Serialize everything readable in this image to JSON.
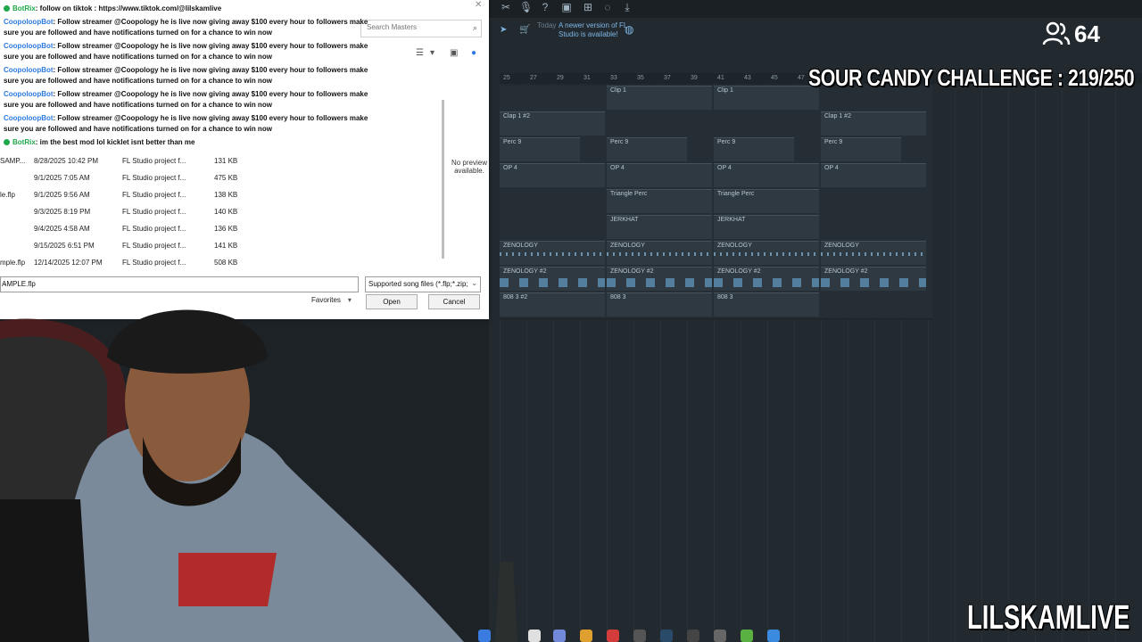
{
  "chat": [
    {
      "user": "BotRix",
      "badge": "green",
      "text": ": follow on tiktok : https://www.tiktok.com/@lilskamlive"
    },
    {
      "user": "CoopoloopBot",
      "badge": "none",
      "text": ": Follow streamer @Coopology he is live now giving away $100 every hour to followers make sure you are followed and have notifications turned on for a chance to win now"
    },
    {
      "user": "CoopoloopBot",
      "badge": "none",
      "text": ": Follow streamer @Coopology he is live now giving away $100 every hour to followers make sure you are followed and have notifications turned on for a chance to win now"
    },
    {
      "user": "CoopoloopBot",
      "badge": "none",
      "text": ": Follow streamer @Coopology he is live now giving away $100 every hour to followers make sure you are followed and have notifications turned on for a chance to win now"
    },
    {
      "user": "CoopoloopBot",
      "badge": "none",
      "text": ": Follow streamer @Coopology he is live now giving away $100 every hour to followers make sure you are followed and have notifications turned on for a chance to win now"
    },
    {
      "user": "CoopoloopBot",
      "badge": "none",
      "text": ": Follow streamer @Coopology he is live now giving away $100 every hour to followers make sure you are followed and have notifications turned on for a chance to win now"
    },
    {
      "user": "BotRix",
      "badge": "green",
      "text": ": im the best mod lol kicklet isnt better than me"
    }
  ],
  "dialog": {
    "search_placeholder": "Search Masters",
    "preview_text": "No preview available.",
    "files": [
      {
        "name": "SAMP...",
        "date": "8/28/2025 10:42 PM",
        "type": "FL Studio project f...",
        "size": "131 KB"
      },
      {
        "name": "",
        "date": "9/1/2025 7:05 AM",
        "type": "FL Studio project f...",
        "size": "475 KB"
      },
      {
        "name": "le.flp",
        "date": "9/1/2025 9:56 AM",
        "type": "FL Studio project f...",
        "size": "138 KB"
      },
      {
        "name": "",
        "date": "9/3/2025 8:19 PM",
        "type": "FL Studio project f...",
        "size": "140 KB"
      },
      {
        "name": "",
        "date": "9/4/2025 4:58 AM",
        "type": "FL Studio project f...",
        "size": "136 KB"
      },
      {
        "name": "",
        "date": "9/15/2025 6:51 PM",
        "type": "FL Studio project f...",
        "size": "141 KB"
      },
      {
        "name": "mple.flp",
        "date": "12/14/2025 12:07 PM",
        "type": "FL Studio project f...",
        "size": "508 KB"
      }
    ],
    "filename_value": "AMPLE.flp",
    "filetype_value": "Supported song files (*.flp;*.zip;",
    "favorites_label": "Favorites",
    "open_label": "Open",
    "cancel_label": "Cancel"
  },
  "fl": {
    "news_today": "Today",
    "news_message": "A newer version of FL Studio is available!",
    "ruler_ticks": [
      "25",
      "27",
      "29",
      "31",
      "33",
      "35",
      "37",
      "39",
      "41",
      "43",
      "45",
      "47"
    ],
    "tracks": [
      {
        "clips": [
          {
            "label": "Clip 1"
          },
          {
            "label": "Clip 1"
          }
        ]
      },
      {
        "clips": [
          {
            "label": "Clap 1 #2"
          },
          {
            "label": "Clap 1 #2"
          }
        ]
      },
      {
        "clips": [
          {
            "label": "Perc 9"
          },
          {
            "label": "Perc 9"
          },
          {
            "label": "Perc 9"
          },
          {
            "label": "Perc 9"
          }
        ]
      },
      {
        "clips": [
          {
            "label": "OP 4"
          },
          {
            "label": "OP 4"
          },
          {
            "label": "OP 4"
          },
          {
            "label": "OP 4"
          }
        ]
      },
      {
        "clips": [
          {
            "label": "Triangle Perc"
          },
          {
            "label": "Triangle Perc"
          }
        ]
      },
      {
        "clips": [
          {
            "label": "JERKHAT"
          },
          {
            "label": "JERKHAT"
          }
        ]
      },
      {
        "clips": [
          {
            "label": "ZENOLOGY"
          },
          {
            "label": "ZENOLOGY"
          },
          {
            "label": "ZENOLOGY"
          },
          {
            "label": "ZENOLOGY"
          }
        ]
      },
      {
        "clips": [
          {
            "label": "ZENOLOGY #2"
          },
          {
            "label": "ZENOLOGY #2"
          },
          {
            "label": "ZENOLOGY #2"
          },
          {
            "label": "ZENOLOGY #2"
          }
        ]
      },
      {
        "clips": [
          {
            "label": "808 3 #2"
          },
          {
            "label": "808 3"
          },
          {
            "label": "808 3"
          }
        ]
      }
    ]
  },
  "overlay": {
    "viewer_count": "64",
    "challenge": "SOUR CANDY CHALLENGE : 219/250",
    "channel": "LILSKAMLIVE"
  }
}
